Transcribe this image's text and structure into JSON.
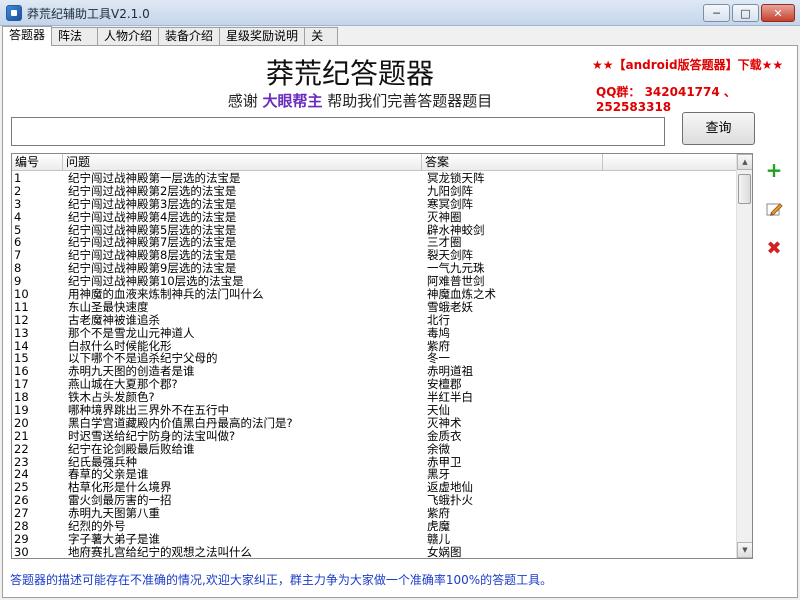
{
  "window": {
    "title": "莽荒纪辅助工具V2.1.0",
    "min_label": "─",
    "max_label": "□",
    "close_label": "✕"
  },
  "tabs": [
    {
      "label": "答题器"
    },
    {
      "label": "阵法"
    },
    {
      "label": "人物介绍"
    },
    {
      "label": "装备介绍"
    },
    {
      "label": "星级奖励说明"
    },
    {
      "label": "关于"
    }
  ],
  "header": {
    "title": "莽荒纪答题器",
    "thanks_prefix": "感谢",
    "helper_name": "大眼帮主",
    "thanks_suffix": "帮助我们完善答题器题目",
    "download": "★★【android版答题器】下载★★",
    "qq": "QQ群： 342041774 、252583318"
  },
  "search": {
    "value": "",
    "placeholder": "",
    "button_label": "查询"
  },
  "table": {
    "columns": [
      "编号",
      "问题",
      "答案",
      ""
    ],
    "rows": [
      [
        "1",
        "纪宁闯过战神殿第一层选的法宝是",
        "冥龙锁天阵"
      ],
      [
        "2",
        "纪宁闯过战神殿第2层选的法宝是",
        "九阳剑阵"
      ],
      [
        "3",
        "纪宁闯过战神殿第3层选的法宝是",
        "寒冥剑阵"
      ],
      [
        "4",
        "纪宁闯过战神殿第4层选的法宝是",
        "灭神圈"
      ],
      [
        "5",
        "纪宁闯过战神殿第5层选的法宝是",
        "辟水神蛟剑"
      ],
      [
        "6",
        "纪宁闯过战神殿第7层选的法宝是",
        "三才圈"
      ],
      [
        "7",
        "纪宁闯过战神殿第8层选的法宝是",
        "裂天剑阵"
      ],
      [
        "8",
        "纪宁闯过战神殿第9层选的法宝是",
        "一气九元珠"
      ],
      [
        "9",
        "纪宁闯过战神殿第10层选的法宝是",
        "阿难普世剑"
      ],
      [
        "10",
        "用神魔的血液来炼制神兵的法门叫什么",
        "神魔血炼之术"
      ],
      [
        "11",
        "东山圣最快速度",
        "雪蛾老妖"
      ],
      [
        "12",
        "古老魔神被谁追杀",
        "北行"
      ],
      [
        "13",
        "那个不是雪龙山元神道人",
        "毒鸠"
      ],
      [
        "14",
        "白叔什么时候能化形",
        "紫府"
      ],
      [
        "15",
        "以下哪个不是追杀纪宁父母的",
        "冬一"
      ],
      [
        "16",
        "赤明九天图的创造者是谁",
        "赤明道祖"
      ],
      [
        "17",
        "燕山城在大夏那个郡?",
        "安檀郡"
      ],
      [
        "18",
        "铁木占头发颜色?",
        "半红半白"
      ],
      [
        "19",
        "哪种境界跳出三界外不在五行中",
        "天仙"
      ],
      [
        "20",
        "黑白学宫道藏殿内价值黑白丹最高的法门是?",
        "灭神术"
      ],
      [
        "21",
        "时迟雪送给纪宁防身的法宝叫做?",
        "金质衣"
      ],
      [
        "22",
        "纪宁在论剑殿最后败给谁",
        "余微"
      ],
      [
        "23",
        "纪氏最强兵种",
        "赤甲卫"
      ],
      [
        "24",
        "春草的父亲是谁",
        "黑牙"
      ],
      [
        "25",
        "枯草化形是什么境界",
        "返虚地仙"
      ],
      [
        "26",
        "雷火剑最厉害的一招",
        "飞蛾扑火"
      ],
      [
        "27",
        "赤明九天图第八重",
        "紫府"
      ],
      [
        "28",
        "纪烈的外号",
        "虎魔"
      ],
      [
        "29",
        "字子薯大弟子是谁",
        "赣儿"
      ],
      [
        "30",
        "地府赛扎宫给纪宁的观想之法叫什么",
        "女娲图"
      ]
    ]
  },
  "side_icons": {
    "add": "+",
    "delete": "✖"
  },
  "footer": "答题器的描述可能存在不准确的情况,欢迎大家纠正，群主力争为大家做一个准确率100%的答题工具。"
}
